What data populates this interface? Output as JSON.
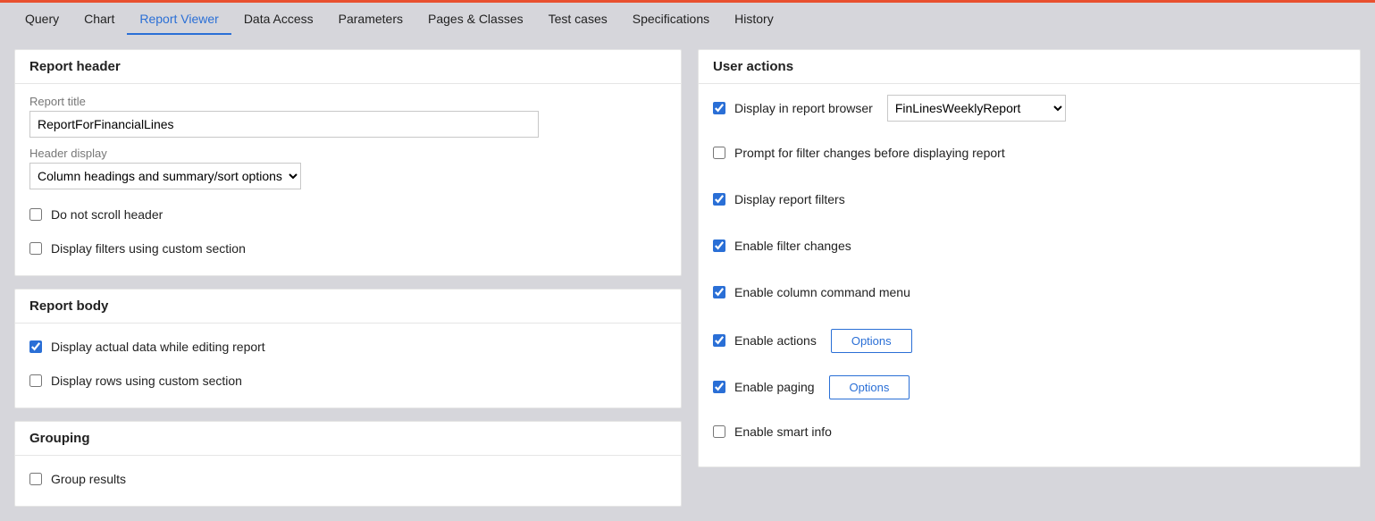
{
  "tabs": {
    "query": "Query",
    "chart": "Chart",
    "report_viewer": "Report Viewer",
    "data_access": "Data Access",
    "parameters": "Parameters",
    "pages_classes": "Pages & Classes",
    "test_cases": "Test cases",
    "specifications": "Specifications",
    "history": "History"
  },
  "report_header": {
    "title": "Report header",
    "report_title_label": "Report title",
    "report_title_value": "ReportForFinancialLines",
    "header_display_label": "Header display",
    "header_display_value": "Column headings and summary/sort options",
    "do_not_scroll": "Do not scroll header",
    "display_filters_custom": "Display filters using custom section"
  },
  "report_body": {
    "title": "Report body",
    "display_actual": "Display actual data while editing report",
    "display_rows_custom": "Display rows using custom section"
  },
  "grouping": {
    "title": "Grouping",
    "group_results": "Group results"
  },
  "user_actions": {
    "title": "User actions",
    "display_in_browser": "Display in report browser",
    "browser_value": "FinLinesWeeklyReport",
    "prompt_filter": "Prompt for filter changes before displaying report",
    "display_filters": "Display report filters",
    "enable_filter_changes": "Enable filter changes",
    "enable_column_cmd": "Enable column command menu",
    "enable_actions": "Enable actions",
    "enable_paging": "Enable paging",
    "enable_smart_info": "Enable smart info",
    "options_btn": "Options"
  }
}
